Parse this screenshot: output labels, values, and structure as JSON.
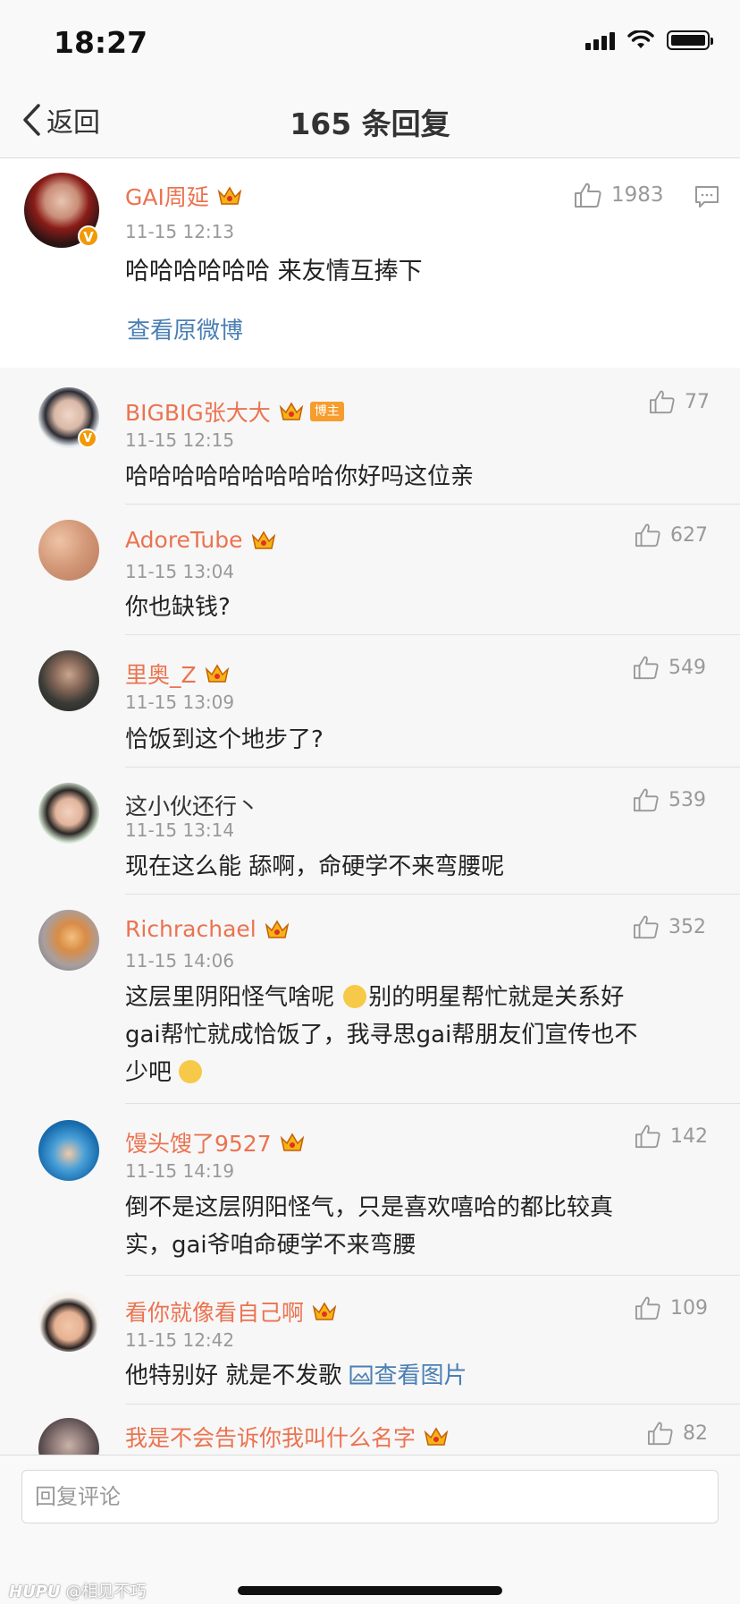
{
  "status_bar": {
    "time": "18:27"
  },
  "nav": {
    "back_label": "返回",
    "title": "165 条回复"
  },
  "main_post": {
    "username": "GAI周延",
    "timestamp": "11-15 12:13",
    "content": "哈哈哈哈哈哈 来友情互捧下",
    "likes": "1983",
    "view_original": "查看原微博"
  },
  "replies": [
    {
      "username": "BIGBIG张大大",
      "tag": "博主",
      "timestamp": "11-15 12:15",
      "content": "哈哈哈哈哈哈哈哈哈你好吗这位亲",
      "likes": "77"
    },
    {
      "username": "AdoreTube",
      "timestamp": "11-15 13:04",
      "content": "你也缺钱?",
      "likes": "627"
    },
    {
      "username": "里奥_Z",
      "timestamp": "11-15 13:09",
      "content": "恰饭到这个地步了?",
      "likes": "549"
    },
    {
      "username": "这小伙还行丶",
      "timestamp": "11-15 13:14",
      "content": "现在这么能 舔啊，命硬学不来弯腰呢",
      "likes": "539"
    },
    {
      "username": "Richrachael",
      "timestamp": "11-15 14:06",
      "content_line1": "这层里阴阳怪气啥呢 ",
      "content_line1b": "别的明星帮忙就是关系好",
      "content_line2": "gai帮忙就成恰饭了，我寻思gai帮朋友们宣传也不",
      "content_line3": "少吧 ",
      "likes": "352"
    },
    {
      "username": "馒头馊了9527",
      "timestamp": "11-15 14:19",
      "content_line1": "倒不是这层阴阳怪气，只是喜欢嘻哈的都比较真",
      "content_line2": "实，gai爷咱命硬学不来弯腰",
      "likes": "142"
    },
    {
      "username": "看你就像看自己啊",
      "timestamp": "11-15 12:42",
      "content": "他特别好 就是不发歌 ",
      "view_image": "查看图片",
      "likes": "109"
    },
    {
      "username": "我是不会告诉你我叫什么名字",
      "likes": "82"
    }
  ],
  "reply_box": {
    "placeholder": "回复评论"
  },
  "watermark": {
    "brand": "HUPU",
    "user": "@相见不巧"
  },
  "colors": {
    "username": "#eb7350",
    "link": "#4a7fb3",
    "badge": "#f19a06",
    "tag": "#f69d2e"
  }
}
